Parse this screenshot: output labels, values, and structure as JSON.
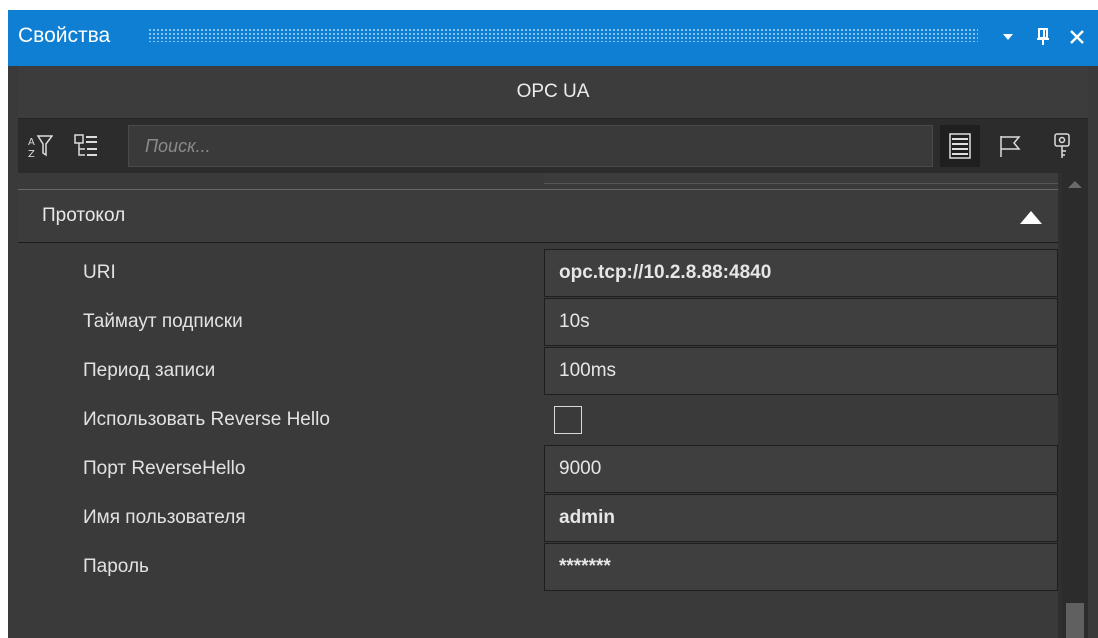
{
  "window": {
    "title": "Свойства",
    "buttons": {
      "dropdown_icon": "chevron-down-icon",
      "pin_icon": "pin-icon",
      "close_icon": "close-icon"
    }
  },
  "object_header": "OPC UA",
  "toolbar": {
    "left_icons": [
      "sort-filter-icon",
      "categorize-icon"
    ],
    "search_placeholder": "Поиск...",
    "right_icons": [
      "properties-list-icon",
      "flag-icon",
      "key-icon"
    ]
  },
  "category": {
    "label": "Протокол",
    "expanded": true
  },
  "properties": [
    {
      "name": "URI",
      "value": "opc.tcp://10.2.8.88:4840",
      "bold": true
    },
    {
      "name": "Таймаут подписки",
      "value": "10s",
      "bold": false
    },
    {
      "name": "Период записи",
      "value": "100ms",
      "bold": false
    },
    {
      "name": "Использовать Reverse Hello",
      "value": "",
      "type": "checkbox",
      "checked": false
    },
    {
      "name": "Порт ReverseHello",
      "value": "9000",
      "bold": false
    },
    {
      "name": "Имя пользователя",
      "value": "admin",
      "bold": true
    },
    {
      "name": "Пароль",
      "value": "*******",
      "bold": true
    }
  ],
  "colors": {
    "title_bar": "#0e7fd2",
    "panel_bg": "#3a3a3a",
    "text": "#e6e6e6"
  }
}
